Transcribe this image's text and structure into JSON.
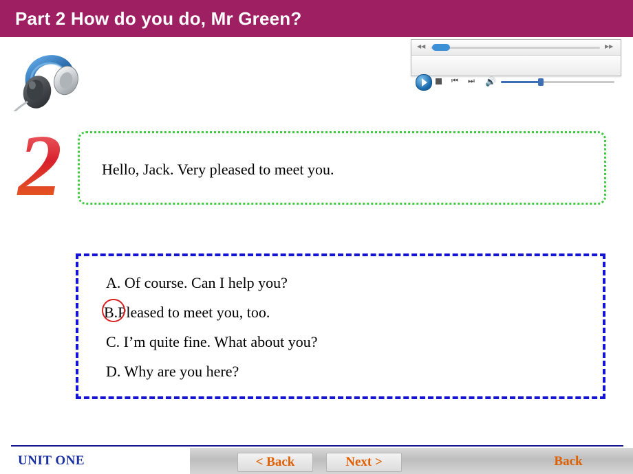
{
  "header": {
    "title": "Part 2 How do you do, Mr Green?",
    "background_color": "#9e2063",
    "text_color": "#ffffff"
  },
  "media_player": {
    "play_icon": "play-icon",
    "stop_icon": "stop-icon",
    "previous_icon": "previous-track-icon",
    "next_icon": "next-track-icon",
    "volume_icon": "volume-icon",
    "rewind_icon": "rewind-icon",
    "fast_forward_icon": "fast-forward-icon",
    "previous_glyph": "⏮",
    "next_glyph": "⏭",
    "volume_glyph": "🔊",
    "rewind_glyph": "◀◀",
    "fast_forward_glyph": "▶▶"
  },
  "illustration": {
    "headset_alt": "headset-illustration",
    "number_label": "2"
  },
  "question": {
    "prompt": "Hello, Jack. Very pleased to meet you.",
    "border_color": "#3ec93e"
  },
  "options": {
    "border_color": "#1414d2",
    "selected": "B",
    "items": [
      {
        "label": "A. Of course. Can I help you?"
      },
      {
        "label": "B.Pleased to meet you, too."
      },
      {
        "label": "C. I’m quite fine. What about you?"
      },
      {
        "label": "D. Why are you here?"
      }
    ]
  },
  "footer": {
    "unit": "UNIT ONE",
    "back_button": "< Back",
    "next_button": "Next >",
    "back_link": "Back",
    "accent_color": "#e06000",
    "unit_color": "#1a2fa0"
  }
}
